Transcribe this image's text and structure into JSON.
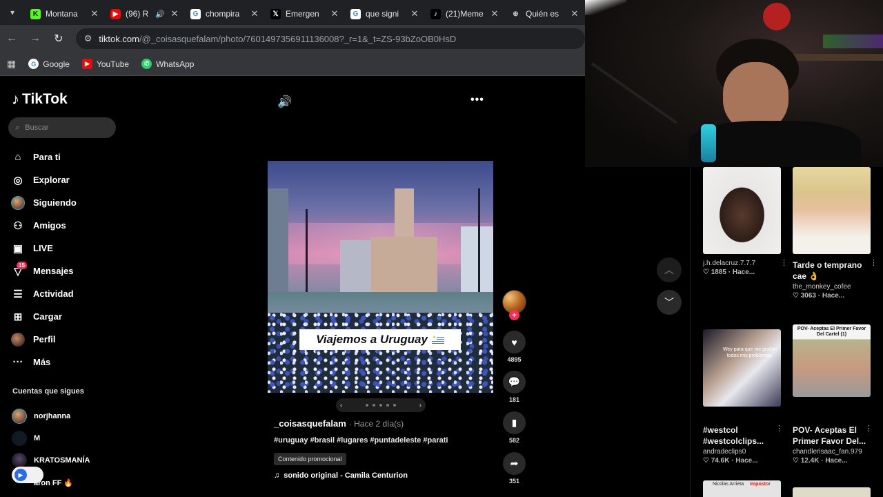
{
  "browser": {
    "tabs": [
      {
        "label": "Montana",
        "icon": "kick-icon",
        "color": "#53fc18"
      },
      {
        "label": "(96) R",
        "icon": "youtube-icon",
        "color": "#ff0000",
        "sound": true
      },
      {
        "label": "chompira",
        "icon": "google-icon",
        "color": "#4285f4"
      },
      {
        "label": "Emergen",
        "icon": "x-icon",
        "color": "#000000"
      },
      {
        "label": "que signi",
        "icon": "google-icon",
        "color": "#4285f4"
      },
      {
        "label": "(21)Meme",
        "icon": "tiktok-icon",
        "color": "#000000"
      },
      {
        "label": "Quién es",
        "icon": "globe-icon",
        "color": "#5f6368"
      }
    ],
    "url_host": "tiktok.com",
    "url_path": "/@_coisasquefalam/photo/7601497356911136008?_r=1&_t=ZS-93bZoOB0HsD",
    "bookmarks": [
      {
        "label": "Google",
        "icon": "google-icon"
      },
      {
        "label": "YouTube",
        "icon": "youtube-icon"
      },
      {
        "label": "WhatsApp",
        "icon": "whatsapp-icon"
      }
    ]
  },
  "tiktok": {
    "brand": "TikTok",
    "search_placeholder": "Buscar",
    "nav": [
      {
        "label": "Para ti",
        "icon": "home-icon"
      },
      {
        "label": "Explorar",
        "icon": "compass-icon"
      },
      {
        "label": "Siguiendo",
        "icon": "following-avatar-icon"
      },
      {
        "label": "Amigos",
        "icon": "friends-icon"
      },
      {
        "label": "LIVE",
        "icon": "live-icon"
      },
      {
        "label": "Mensajes",
        "icon": "messages-icon",
        "badge": "15"
      },
      {
        "label": "Actividad",
        "icon": "activity-icon"
      },
      {
        "label": "Cargar",
        "icon": "upload-icon"
      },
      {
        "label": "Perfil",
        "icon": "profile-avatar-icon"
      },
      {
        "label": "Más",
        "icon": "more-icon"
      }
    ],
    "following_title": "Cuentas que sigues",
    "following": [
      {
        "name": "norjhanna"
      },
      {
        "name": "M"
      },
      {
        "name": "KRATOSMANÍA"
      },
      {
        "name": "aron FF 🔥"
      }
    ]
  },
  "post": {
    "overlay_text": "Viajemos a Uruguay",
    "author": "_coisasquefalam",
    "posted": "· Hace 2 día(s)",
    "hashtags": "#uruguay #brasil #lugares #puntadeleste #parati",
    "promo_label": "Contenido promocional",
    "sound": "sonido original - Camila Centurion",
    "likes": "4895",
    "comments": "181",
    "saves": "582",
    "shares": "351"
  },
  "recommendations": [
    {
      "title": "",
      "user": "j.h.delacruz.7.7.7",
      "stat": "1885 · Hace..."
    },
    {
      "title": "Tarde o temprano cae 👌",
      "user": "the_monkey_cofee",
      "stat": "3063 · Hace..."
    },
    {
      "title": "#westcol #westcolclips...",
      "user": "andradeclips0",
      "stat": "74.6K · Hace..."
    },
    {
      "title": "POV- Aceptas El Primer Favor Del...",
      "user": "chandlerisaac_fan.979",
      "stat": "12.4K · Hace..."
    }
  ],
  "thumb_texts": {
    "westcol": "Wey para que me gustan todos mis problemas.",
    "pov": "POV- Aceptas El Primer Favor Del Cartel (1)",
    "bottom_left": "Nicolas Arrieta",
    "bottom_left_tag": "Impostor"
  }
}
